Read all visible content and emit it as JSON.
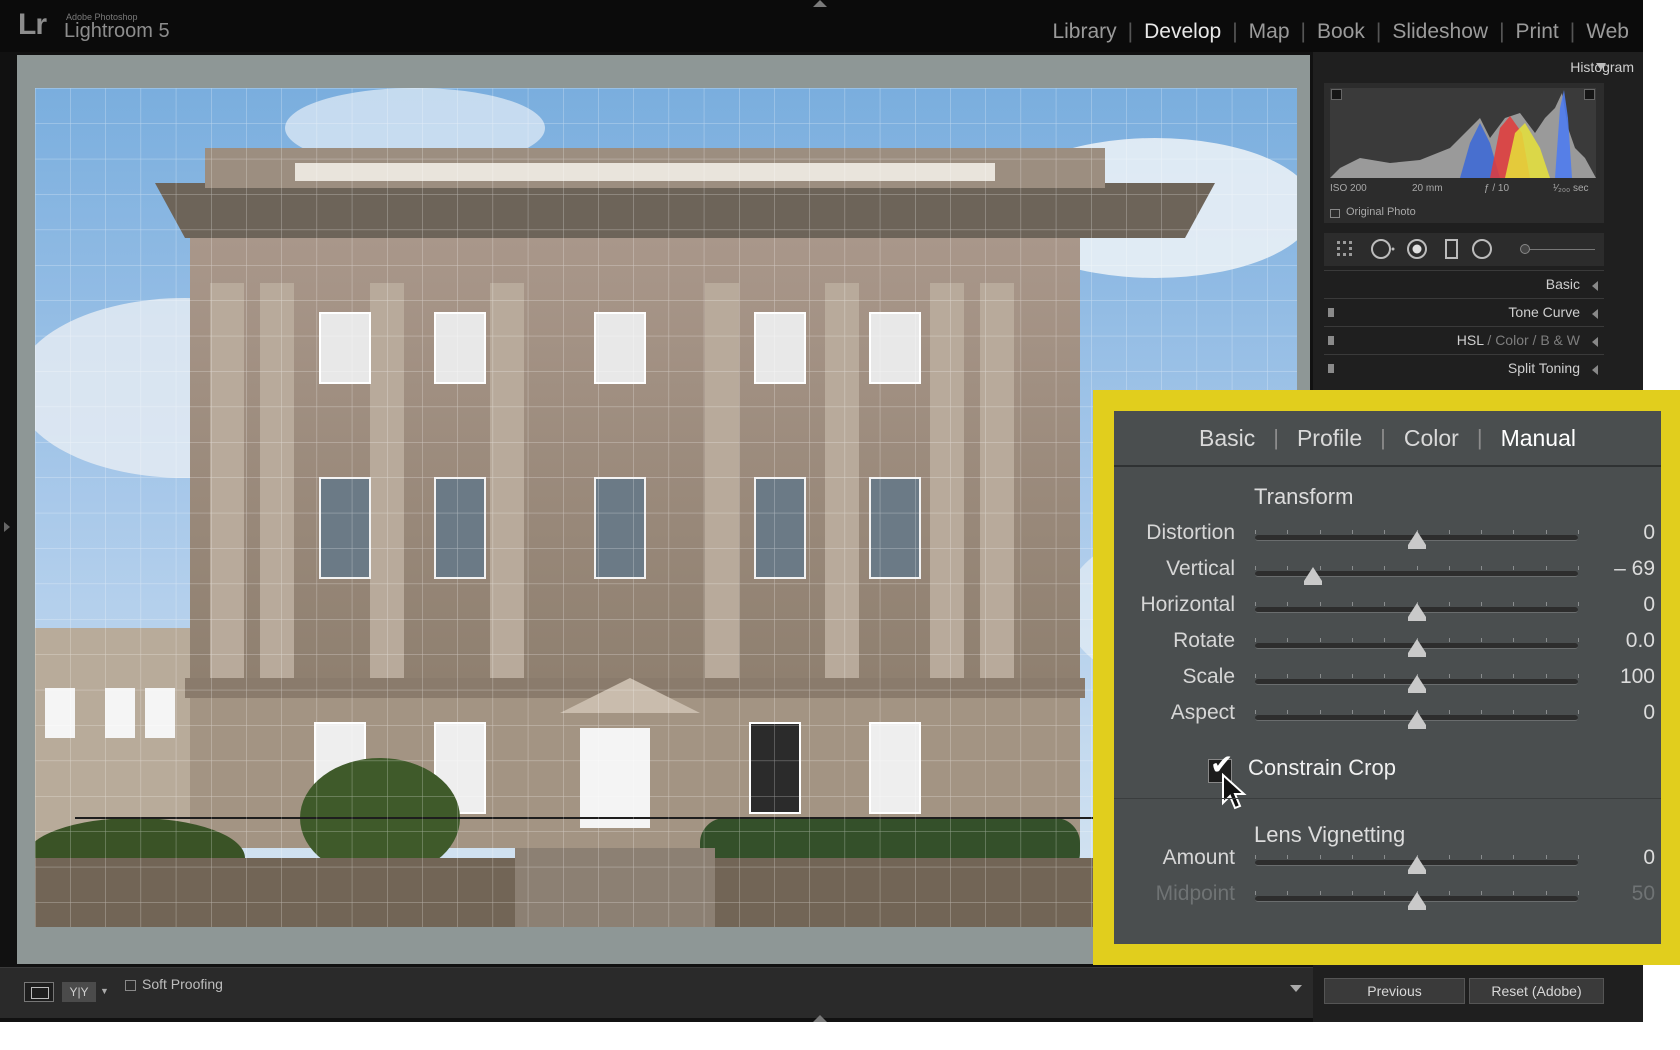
{
  "app": {
    "logo": "Lr",
    "vendor": "Adobe Photoshop",
    "name": "Lightroom 5"
  },
  "modules": [
    {
      "label": "Library",
      "active": false
    },
    {
      "label": "Develop",
      "active": true
    },
    {
      "label": "Map",
      "active": false
    },
    {
      "label": "Book",
      "active": false
    },
    {
      "label": "Slideshow",
      "active": false
    },
    {
      "label": "Print",
      "active": false
    },
    {
      "label": "Web",
      "active": false
    }
  ],
  "toolbar": {
    "yy_label": "Y|Y",
    "soft_proofing": "Soft Proofing"
  },
  "histogram": {
    "title": "Histogram",
    "iso": "ISO 200",
    "focal": "20 mm",
    "aperture": "ƒ / 10",
    "shutter": "¹⁄₂₀₀ sec",
    "original_photo": "Original Photo"
  },
  "panels": {
    "basic": "Basic",
    "tone_curve": "Tone Curve",
    "hsl_a": "HSL",
    "hsl_sep1": "/",
    "hsl_b": "Color",
    "hsl_sep2": "/",
    "hsl_c": "B & W",
    "split_toning": "Split Toning"
  },
  "buttons": {
    "previous": "Previous",
    "reset": "Reset (Adobe)"
  },
  "lens": {
    "tabs": [
      "Basic",
      "Profile",
      "Color",
      "Manual"
    ],
    "active_tab": "Manual",
    "transform_title": "Transform",
    "transform": [
      {
        "label": "Distortion",
        "value": "0",
        "pos": 0.5
      },
      {
        "label": "Vertical",
        "value": "– 69",
        "pos": 0.18
      },
      {
        "label": "Horizontal",
        "value": "0",
        "pos": 0.5
      },
      {
        "label": "Rotate",
        "value": "0.0",
        "pos": 0.5
      },
      {
        "label": "Scale",
        "value": "100",
        "pos": 0.5
      },
      {
        "label": "Aspect",
        "value": "0",
        "pos": 0.5
      }
    ],
    "constrain_crop": "Constrain Crop",
    "constrain_checked": true,
    "vignetting_title": "Lens Vignetting",
    "vignetting": [
      {
        "label": "Amount",
        "value": "0",
        "pos": 0.5,
        "dim": false
      },
      {
        "label": "Midpoint",
        "value": "50",
        "pos": 0.5,
        "dim": true
      }
    ]
  }
}
